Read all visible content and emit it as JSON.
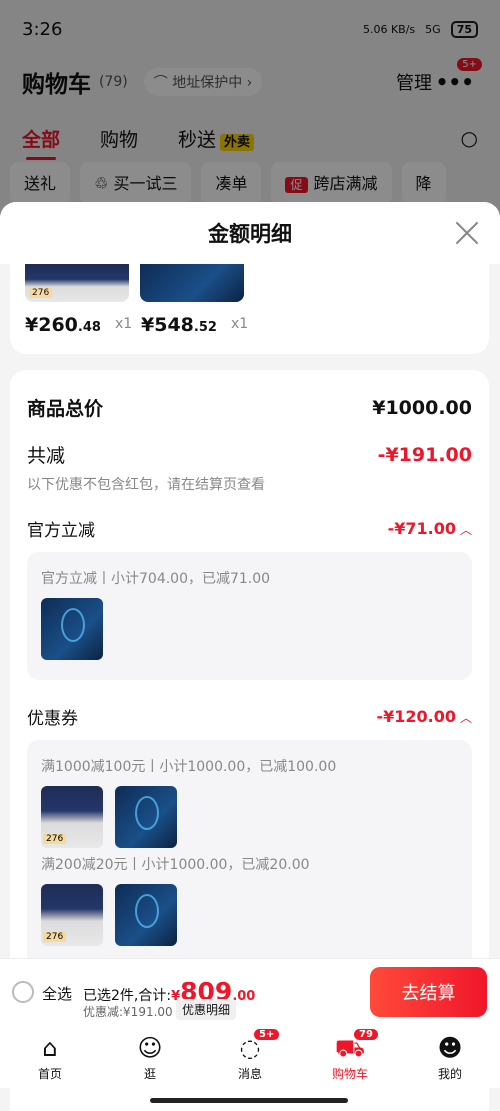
{
  "status": {
    "time": "3:26",
    "speed": "5.06 KB/s",
    "signal": "5G",
    "battery": "75"
  },
  "header": {
    "title": "购物车",
    "count": "(79)",
    "address": "地址保护中",
    "manage": "管理",
    "more_badge": "5+"
  },
  "tabs": [
    {
      "label": "全部"
    },
    {
      "label": "购物"
    },
    {
      "label": "秒送",
      "tag": "外卖"
    }
  ],
  "chips": [
    {
      "label": "送礼"
    },
    {
      "label": "买一试三"
    },
    {
      "label": "凑单"
    },
    {
      "label": "跨店满减",
      "tag": "促"
    },
    {
      "label": "降"
    }
  ],
  "sheet": {
    "title": "金额明细",
    "top_items": [
      {
        "price_int": "¥260",
        "price_dec": ".48",
        "qty": "x1",
        "thumb_label": "276"
      },
      {
        "price_int": "¥548",
        "price_dec": ".52",
        "qty": "x1"
      }
    ],
    "goods_total_label": "商品总价",
    "goods_total": "¥1000.00",
    "reduce_label": "共减",
    "reduce_total": "-¥191.00",
    "reduce_note": "以下优惠不包含红包，请在结算页查看",
    "official": {
      "label": "官方立减",
      "amount": "-¥71.00",
      "detail": "官方立减丨小计704.00，已减71.00"
    },
    "coupon": {
      "label": "优惠券",
      "amount": "-¥120.00",
      "rules": [
        {
          "text": "满1000减100元丨小计1000.00，已减100.00",
          "thumb_label": "276"
        },
        {
          "text": "满200减20元丨小计1000.00，已减20.00",
          "thumb_label": "276"
        }
      ]
    }
  },
  "checkout": {
    "select_all": "全选",
    "selected": "已选2件,合计:",
    "currency": "¥",
    "total_int": "809",
    "total_dec": ".00",
    "discount": "优惠减:¥191.00",
    "detail_button": "优惠明细",
    "submit": "去结算"
  },
  "nav": [
    {
      "label": "首页",
      "icon": "home-icon"
    },
    {
      "label": "逛",
      "icon": "face-icon"
    },
    {
      "label": "消息",
      "icon": "message-icon",
      "badge": "5+"
    },
    {
      "label": "购物车",
      "icon": "cart-icon",
      "badge": "79",
      "active": true
    },
    {
      "label": "我的",
      "icon": "user-icon"
    }
  ],
  "colors": {
    "accent": "#f0162a",
    "muted": "#888888"
  }
}
